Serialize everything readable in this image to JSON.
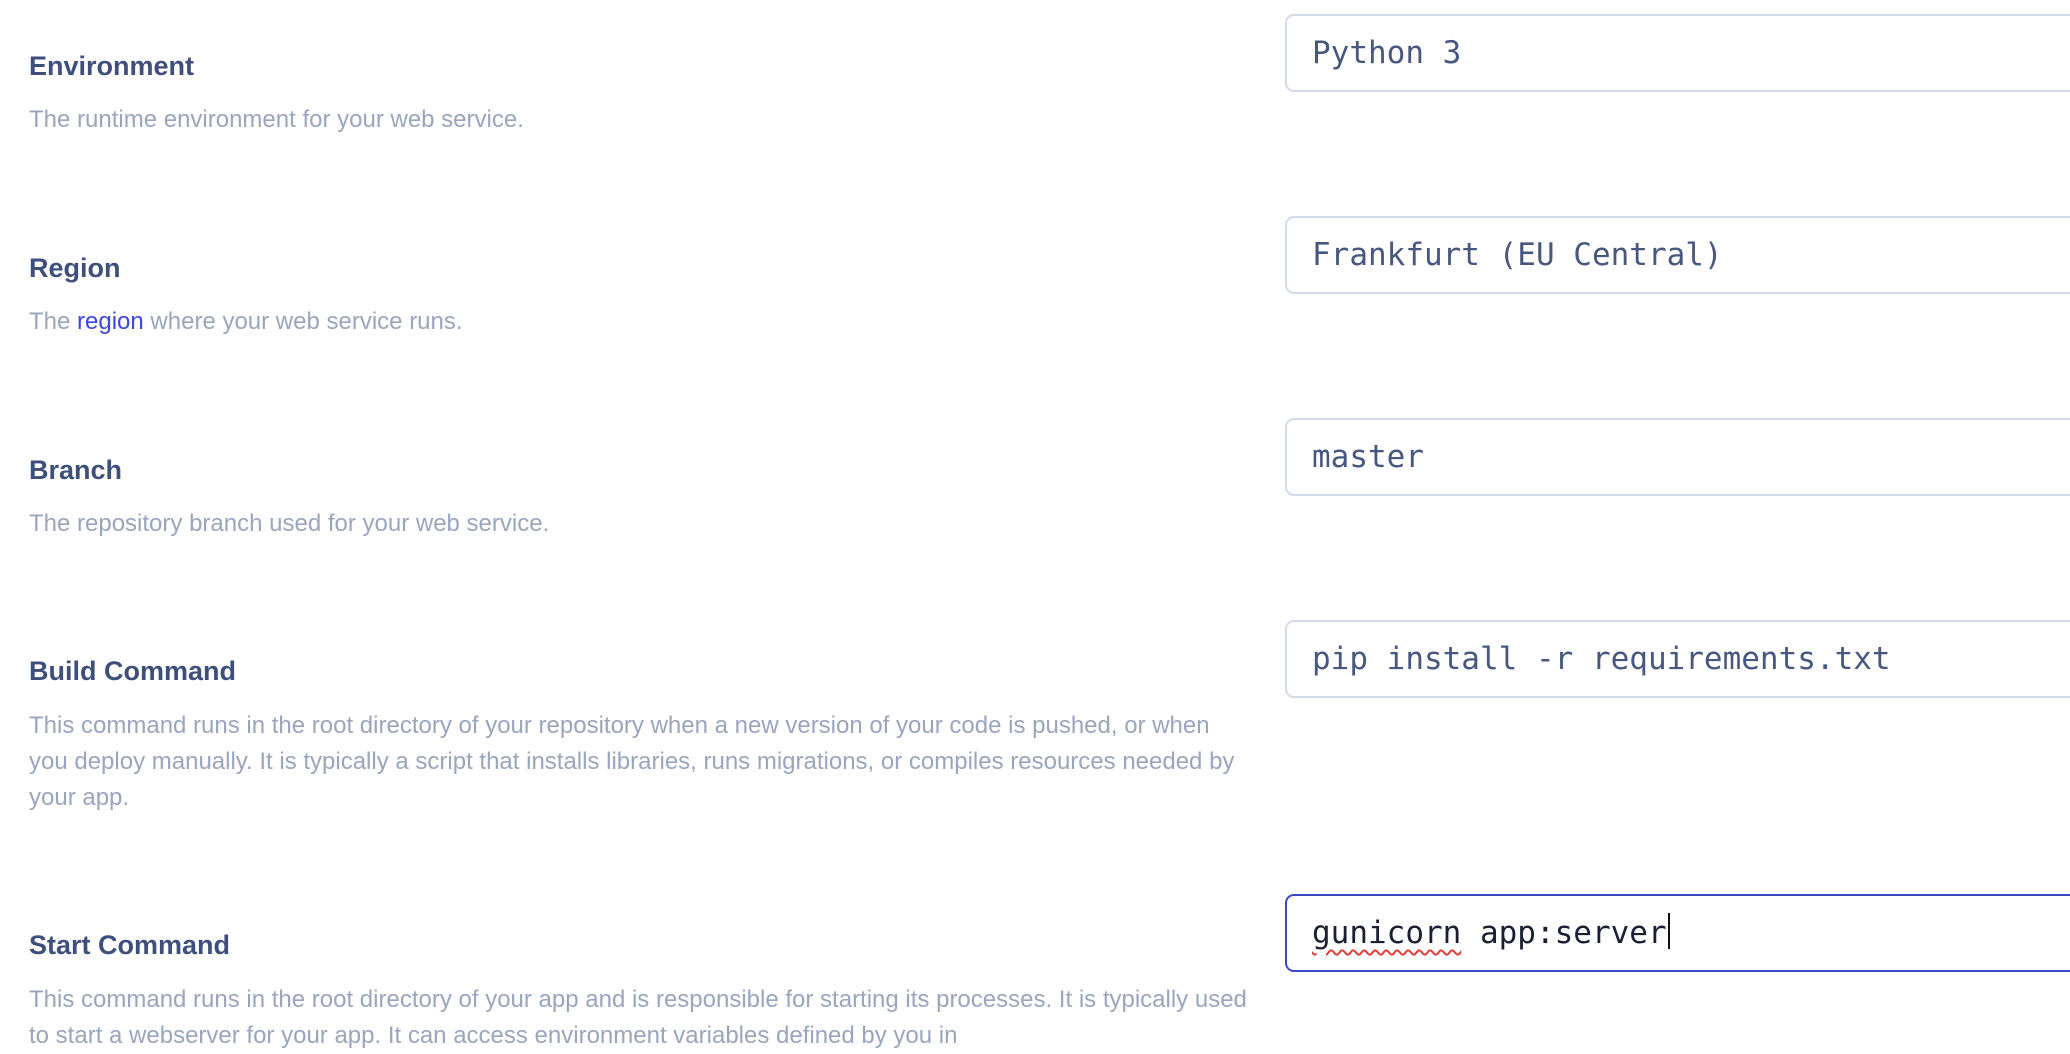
{
  "settings": {
    "environment": {
      "label": "Environment",
      "description": "The runtime environment for your web service.",
      "value": "Python 3"
    },
    "region": {
      "label": "Region",
      "description_prefix": "The ",
      "description_link": "region",
      "description_suffix": " where your web service runs.",
      "value": "Frankfurt (EU Central)"
    },
    "branch": {
      "label": "Branch",
      "description": "The repository branch used for your web service.",
      "value": "master"
    },
    "build_command": {
      "label": "Build Command",
      "description": "This command runs in the root directory of your repository when a new version of your code is pushed, or when you deploy manually. It is typically a script that installs libraries, runs migrations, or compiles resources needed by your app.",
      "value": "pip install -r requirements.txt"
    },
    "start_command": {
      "label": "Start Command",
      "description": "This command runs in the root directory of your app and is responsible for starting its processes. It is typically used to start a webserver for your app. It can access environment variables defined by you in",
      "value_first_word": "gunicorn",
      "value_rest": " app:server"
    }
  },
  "colors": {
    "label": "#3f4f7c",
    "description": "#9aa5be",
    "link": "#3b47e0",
    "field_border": "#d3dcea",
    "field_border_focused": "#3d48c8",
    "spellcheck_underline": "#e0403a"
  }
}
